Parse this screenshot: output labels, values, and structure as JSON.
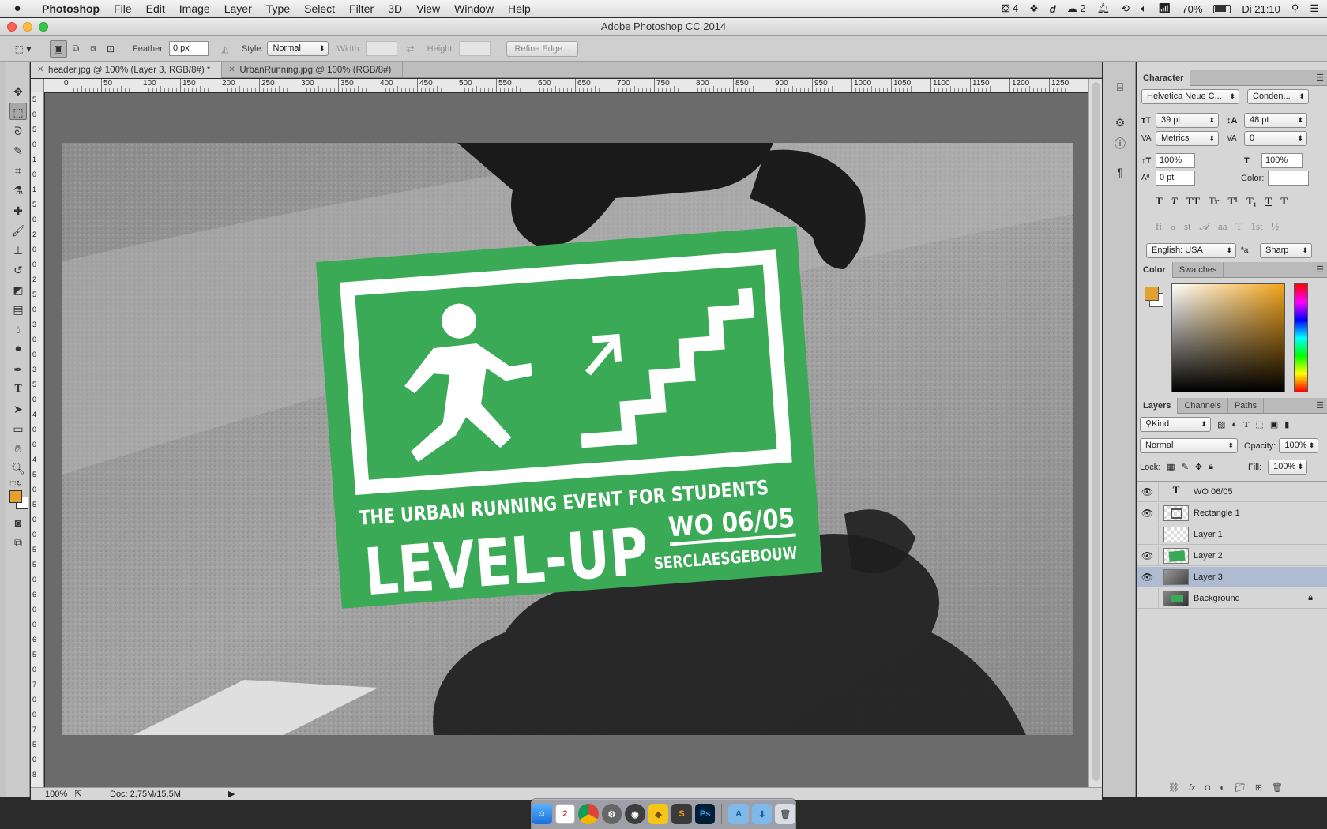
{
  "menubar": {
    "app": "Photoshop",
    "items": [
      "File",
      "Edit",
      "Image",
      "Layer",
      "Type",
      "Select",
      "Filter",
      "3D",
      "View",
      "Window",
      "Help"
    ],
    "status": {
      "adobe_count": "4",
      "cc_count": "2",
      "battery": "70%",
      "clock": "Di 21:10"
    }
  },
  "window": {
    "title": "Adobe Photoshop CC 2014"
  },
  "options": {
    "feather_label": "Feather:",
    "feather_value": "0 px",
    "style_label": "Style:",
    "style_value": "Normal",
    "width_label": "Width:",
    "height_label": "Height:",
    "refine_edge": "Refine Edge..."
  },
  "tabs": [
    {
      "label": "header.jpg @ 100% (Layer 3, RGB/8#) *",
      "active": true
    },
    {
      "label": "UrbanRunning.jpg @ 100% (RGB/8#)",
      "active": false
    }
  ],
  "ruler": {
    "h_ticks": [
      "0",
      "50",
      "100",
      "150",
      "200",
      "250",
      "300",
      "350",
      "400",
      "450",
      "500",
      "550",
      "600",
      "650",
      "700",
      "750",
      "800",
      "850",
      "900",
      "950",
      "1000",
      "1050",
      "1100",
      "1150",
      "1200",
      "1250"
    ],
    "v_ticks": [
      "5",
      "0",
      "5",
      "0",
      "1",
      "0",
      "1",
      "5",
      "0",
      "2",
      "0",
      "0",
      "2",
      "5",
      "0",
      "3",
      "0",
      "0",
      "3",
      "5",
      "0",
      "4",
      "0",
      "0",
      "4",
      "5",
      "0",
      "5",
      "0",
      "0",
      "5",
      "5",
      "0",
      "6",
      "0",
      "0",
      "6",
      "5",
      "0",
      "7",
      "0",
      "0",
      "7",
      "5",
      "0",
      "8"
    ]
  },
  "artwork": {
    "tagline": "THE URBAN RUNNING EVENT FOR STUDENTS",
    "headline": "LEVEL-UP",
    "date": "WO 06/05",
    "venue": "SERCLAESGEBOUW",
    "green": "#3aaa57"
  },
  "status": {
    "zoom": "100%",
    "doc": "Doc: 2,75M/15,5M"
  },
  "character": {
    "tab": "Character",
    "font_family": "Helvetica Neue C...",
    "font_style": "Conden...",
    "size": "39 pt",
    "leading": "48 pt",
    "kerning": "Metrics",
    "tracking": "0",
    "vscale": "100%",
    "hscale": "100%",
    "baseline": "0 pt",
    "color_label": "Color:",
    "language": "English: USA",
    "antialias_icon": "ªa",
    "antialias": "Sharp",
    "style_glyphs": [
      "T",
      "T",
      "TT",
      "Tr",
      "T¹",
      "T₁",
      "T",
      "T"
    ],
    "ot_glyphs": [
      "fi",
      "ℴ",
      "st",
      "𝒜",
      "aa",
      "T",
      "1st",
      "½"
    ]
  },
  "color_panel": {
    "tabs": [
      "Color",
      "Swatches"
    ],
    "foreground": "#e3a12f"
  },
  "layers_panel": {
    "tabs": [
      "Layers",
      "Channels",
      "Paths"
    ],
    "filter": "Kind",
    "blend": "Normal",
    "opacity_label": "Opacity:",
    "opacity": "100%",
    "lock_label": "Lock:",
    "fill_label": "Fill:",
    "fill": "100%",
    "layers": [
      {
        "name": "WO 06/05",
        "visible": true,
        "kind": "text"
      },
      {
        "name": "Rectangle 1",
        "visible": true,
        "kind": "shape"
      },
      {
        "name": "Layer 1",
        "visible": false,
        "kind": "pixel"
      },
      {
        "name": "Layer 2",
        "visible": true,
        "kind": "pixel"
      },
      {
        "name": "Layer 3",
        "visible": true,
        "kind": "photo",
        "selected": true
      },
      {
        "name": "Background",
        "visible": false,
        "kind": "photo",
        "locked": true
      }
    ]
  }
}
